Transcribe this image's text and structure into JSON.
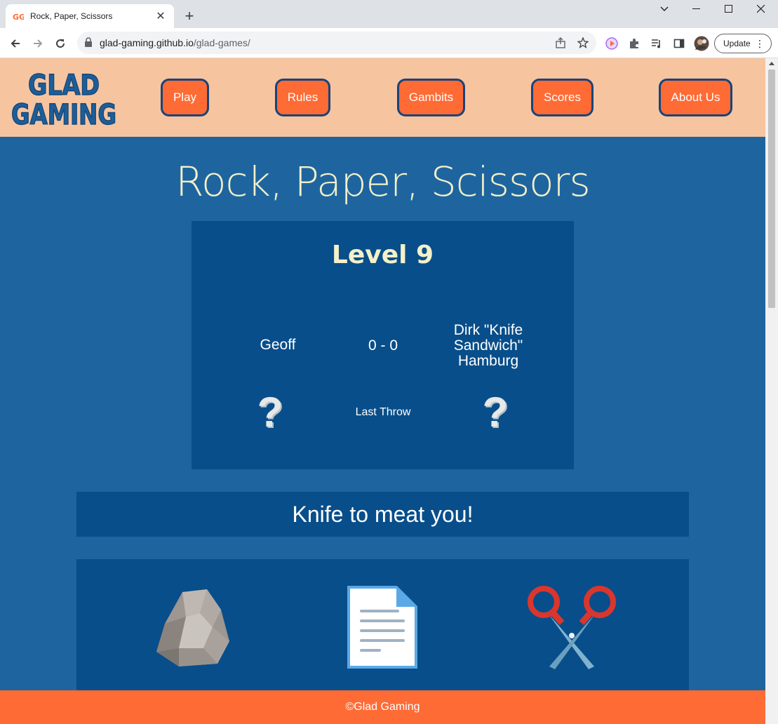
{
  "browser": {
    "tab_title": "Rock, Paper, Scissors",
    "url_domain": "glad-gaming.github.io",
    "url_path": "/glad-games/",
    "update_label": "Update"
  },
  "site": {
    "logo_text_top": "GLAD",
    "logo_text_bottom": "GAMING",
    "nav": [
      "Play",
      "Rules",
      "Gambits",
      "Scores",
      "About Us"
    ],
    "footer": "©Glad Gaming"
  },
  "game": {
    "title": "Rock, Paper, Scissors",
    "level": "Level 9",
    "player_name": "Geoff",
    "score": "0 - 0",
    "opponent_name": "Dirk \"Knife Sandwich\" Hamburg",
    "player_last_throw": "?",
    "opponent_last_throw": "?",
    "last_throw_label": "Last Throw",
    "message": "Knife to meat you!",
    "choices": [
      "rock",
      "paper",
      "scissors"
    ]
  },
  "colors": {
    "header_bg": "#f7c4a0",
    "page_bg": "#1e65a0",
    "panel_bg": "#084e8a",
    "accent": "#ff6b35",
    "title_text": "#f4f0c8"
  }
}
